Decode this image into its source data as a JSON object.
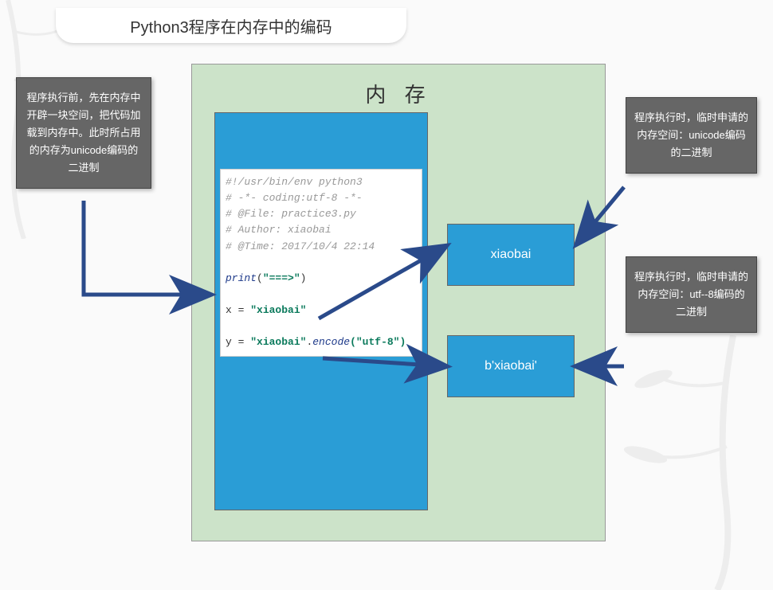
{
  "title": "Python3程序在内存中的编码",
  "memory_heading": "内 存",
  "code": {
    "c1": "#!/usr/bin/env python3",
    "c2": "# -*- coding:utf-8 -*-",
    "c3": "# @File: practice3.py",
    "c4": "# Author: xiaobai",
    "c5": "# @Time: 2017/10/4 22:14",
    "print_fn": "print",
    "print_arg": "\"===>\"",
    "x_lhs": "x = ",
    "x_val": "\"xiaobai\"",
    "y_lhs": "y = ",
    "y_val": "\"xiaobai\"",
    "y_dot": ".",
    "y_enc": "encode",
    "y_arg": "(\"utf-8\")"
  },
  "values": {
    "v1": "xiaobai",
    "v2": "b'xiaobai'"
  },
  "info": {
    "left": "程序执行前，先在内存中开辟一块空间，把代码加载到内存中。此时所占用的内存为unicode编码的二进制",
    "r1": "程序执行时，临时申请的内存空间：unicode编码的二进制",
    "r2": "程序执行时，临时申请的内存空间：utf--8编码的二进制"
  },
  "colors": {
    "panel_bg": "#cce3c9",
    "blue": "#2a9dd6",
    "info_bg": "#666666",
    "arrow": "#2a4a8a"
  }
}
